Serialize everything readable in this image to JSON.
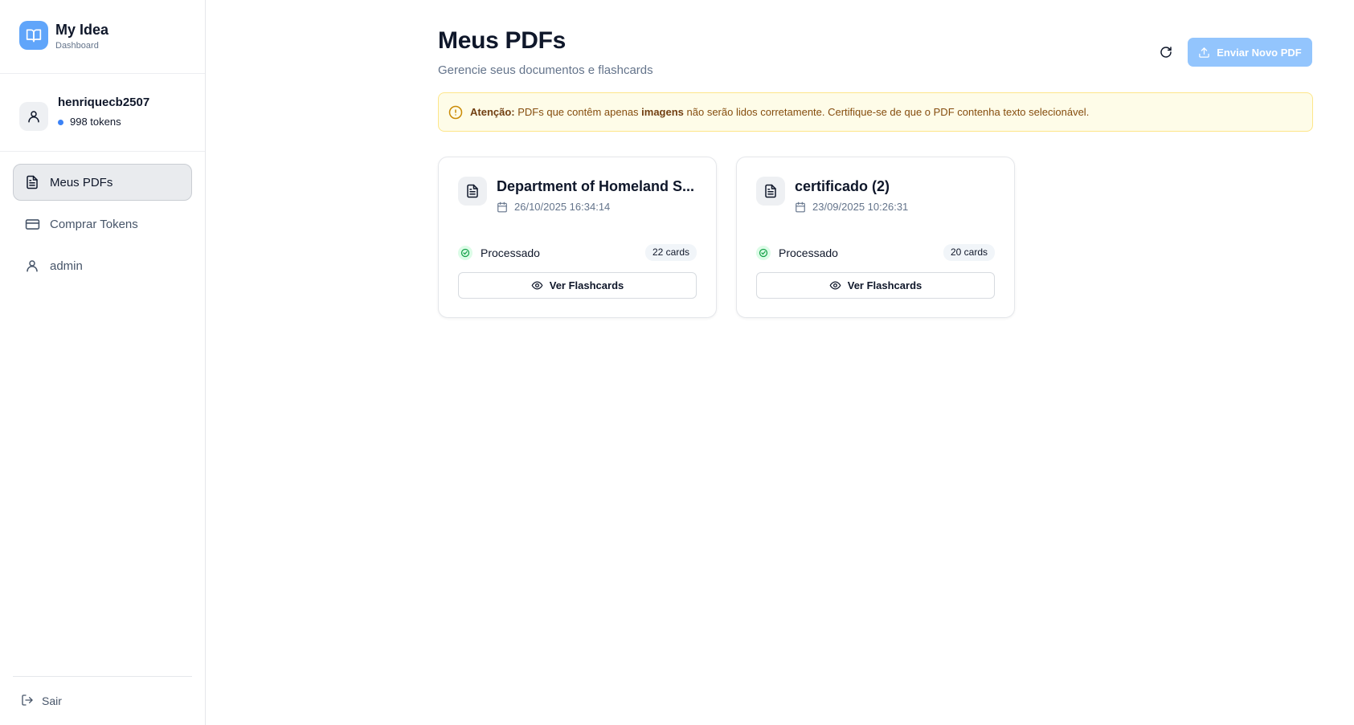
{
  "brand": {
    "title": "My Idea",
    "subtitle": "Dashboard",
    "icon": "book-open-icon"
  },
  "user": {
    "username": "henriquecb2507",
    "tokens": "998 tokens",
    "icon": "user-icon"
  },
  "sidebar": {
    "items": [
      {
        "label": "Meus PDFs",
        "icon": "file-text-icon",
        "active": true
      },
      {
        "label": "Comprar Tokens",
        "icon": "credit-card-icon",
        "active": false
      },
      {
        "label": "admin",
        "icon": "user-icon",
        "active": false
      }
    ],
    "logout_label": "Sair"
  },
  "header": {
    "title": "Meus PDFs",
    "subtitle": "Gerencie seus documentos e flashcards",
    "upload_label": "Enviar Novo PDF"
  },
  "alert": {
    "prefix": "Atenção:",
    "text_before": " PDFs que contêm apenas ",
    "emphasis": "imagens",
    "text_after": " não serão lidos corretamente. Certifique-se de que o PDF contenha texto selecionável."
  },
  "pdfs": [
    {
      "title": "Department of Homeland S...",
      "date": "26/10/2025 16:34:14",
      "status": "Processado",
      "cards": "22 cards",
      "action": "Ver Flashcards"
    },
    {
      "title": "certificado (2)",
      "date": "23/09/2025 10:26:31",
      "status": "Processado",
      "cards": "20 cards",
      "action": "Ver Flashcards"
    }
  ],
  "colors": {
    "accent": "#60a5fa",
    "button": "#93c5fd",
    "alert_bg": "#fefce8",
    "success": "#22c55e"
  }
}
